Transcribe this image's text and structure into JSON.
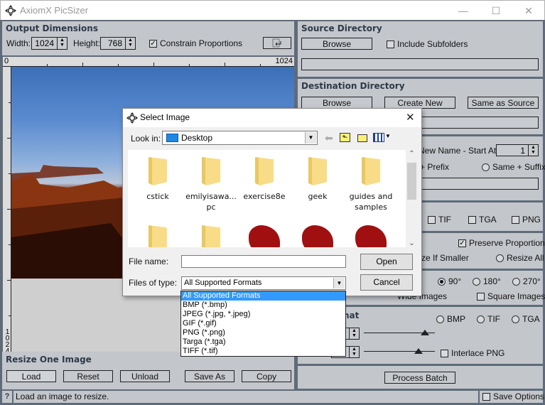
{
  "window": {
    "title": "AxiomX PicSizer",
    "minimize": "—",
    "maximize": "☐",
    "close": "✕"
  },
  "output_dimensions": {
    "title": "Output Dimensions",
    "width_label": "Width:",
    "width_value": "1024",
    "height_label": "Height:",
    "height_value": "768",
    "constrain_label": "Constrain Proportions",
    "constrain_checked": true
  },
  "ruler": {
    "top_start": "0",
    "top_end": "1024",
    "left_end_digits": [
      "1",
      "0",
      "2",
      "4"
    ]
  },
  "resize_one": {
    "title": "Resize One Image",
    "buttons": [
      "Load",
      "Reset",
      "Unload",
      "Save As",
      "Copy"
    ]
  },
  "status": {
    "help": "?",
    "message": "Load an image to resize.",
    "save_options_label": "Save Options"
  },
  "source": {
    "title": "Source Directory",
    "browse": "Browse",
    "include_subfolders": "Include Subfolders",
    "path": ""
  },
  "destination": {
    "title": "Destination Directory",
    "browse": "Browse",
    "create_new": "Create New",
    "same_as_source": "Same as Source",
    "path": ""
  },
  "naming": {
    "new_name_label": "New Name  -  Start At:",
    "start_at": "1",
    "prefix_label": "+ Prefix",
    "suffix_label": "Same + Suffix",
    "name_value": ""
  },
  "types": {
    "tif": "TIF",
    "tga": "TGA",
    "png": "PNG"
  },
  "resize_opts": {
    "preserve": "Preserve Proportions",
    "if_smaller": "Resize If Smaller",
    "resize_all": "Resize All"
  },
  "rotate": {
    "r90": "90°",
    "r180": "180°",
    "r270": "270°",
    "wide": "Wide Images",
    "square": "Square Images"
  },
  "format": {
    "title_partial": "nat",
    "bmp": "BMP",
    "tif": "TIF",
    "tga": "TGA",
    "interlace": "Interlace PNG",
    "jpeg_quality": 0.86,
    "png_compression": 0.77
  },
  "process_batch": "Process Batch",
  "dialog": {
    "title": "Select Image",
    "close": "✕",
    "look_in_label": "Look in:",
    "look_in_value": "Desktop",
    "items": [
      {
        "name": "cstick",
        "type": "folder"
      },
      {
        "name": "emilyisawa...\npc",
        "type": "folder"
      },
      {
        "name": "exercise8e",
        "type": "folder"
      },
      {
        "name": "geek",
        "type": "folder"
      },
      {
        "name": "guides and\nsamples",
        "type": "folder"
      },
      {
        "name": "",
        "type": "folder"
      },
      {
        "name": "",
        "type": "folder"
      },
      {
        "name": "",
        "type": "image"
      },
      {
        "name": "",
        "type": "image"
      },
      {
        "name": "",
        "type": "image"
      }
    ],
    "file_name_label": "File name:",
    "file_name_value": "",
    "files_of_type_label": "Files of type:",
    "files_of_type_value": "All Supported Formats",
    "open": "Open",
    "cancel": "Cancel",
    "type_options": [
      "All Supported Formats",
      "BMP (*.bmp)",
      "JPEG (*.jpg, *.jpeg)",
      "GIF (*.gif)",
      "PNG (*.png)",
      "Targa (*.tga)",
      "TIFF (*.tif)"
    ]
  },
  "colors": {
    "panel": "#c3c6cb",
    "frame": "#5f6b78",
    "title_text": "#2e3a4a",
    "selection": "#3399ff"
  }
}
